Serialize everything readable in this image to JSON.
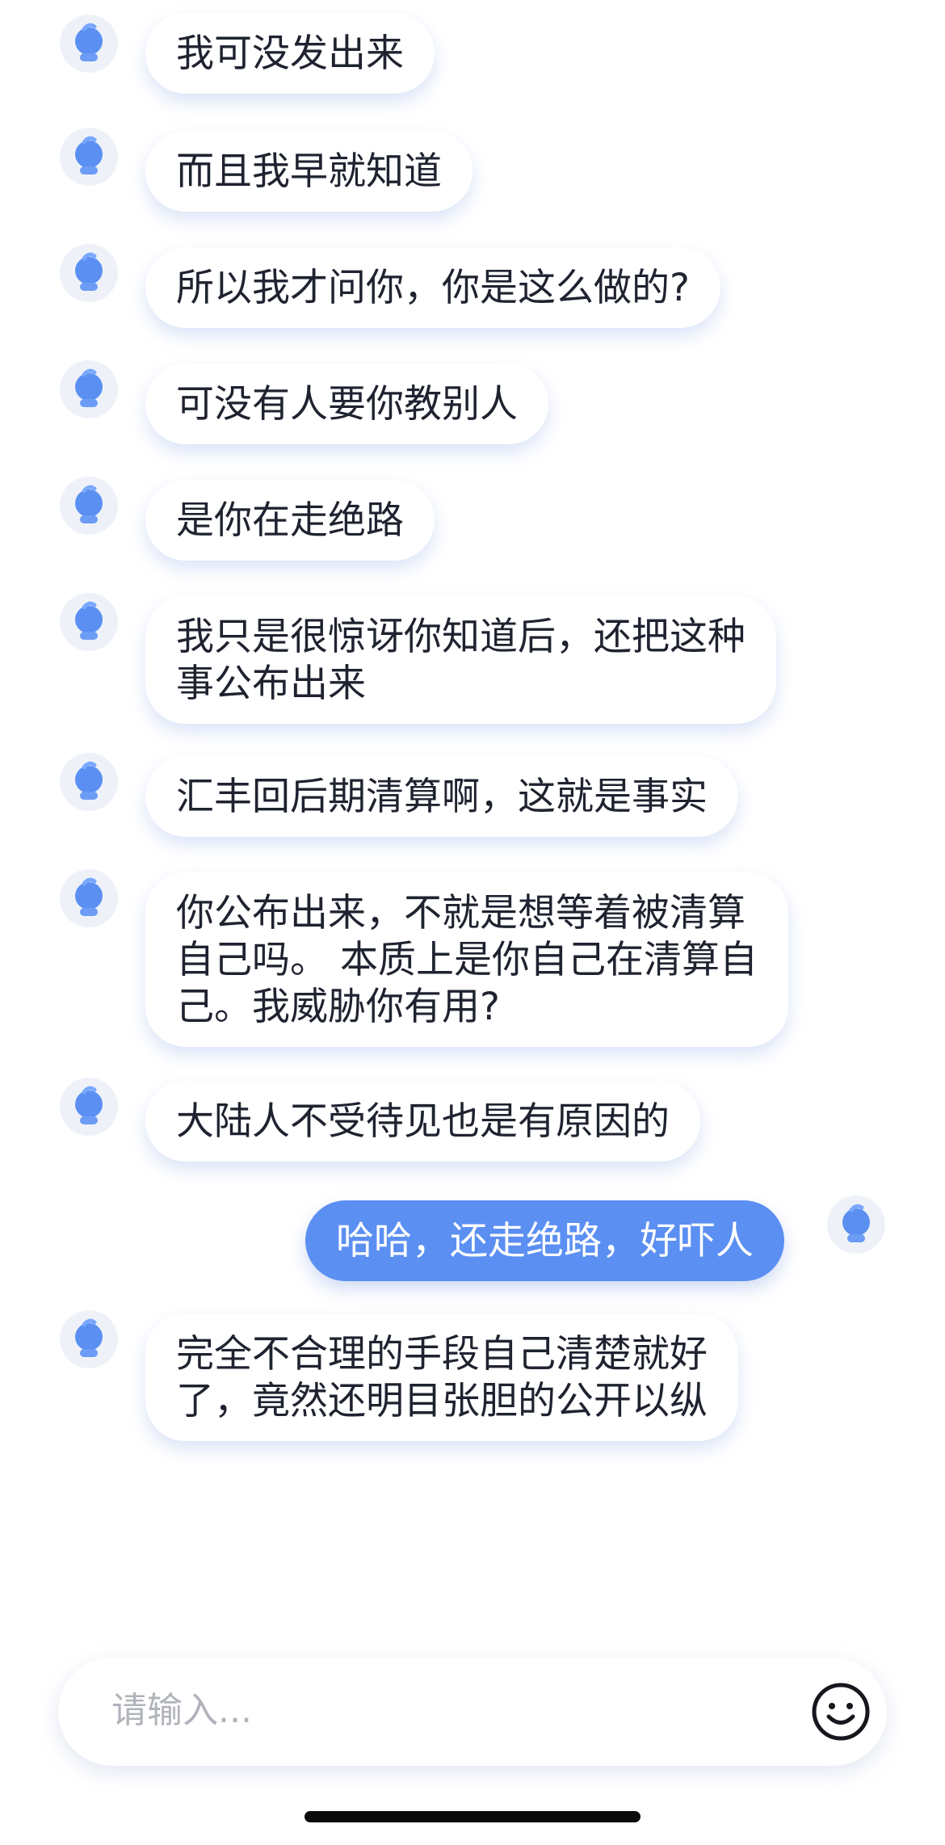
{
  "messages": [
    {
      "side": "received",
      "text": "我可没发出来"
    },
    {
      "side": "received",
      "text": "而且我早就知道"
    },
    {
      "side": "received",
      "text": "所以我才问你，你是这么做的?"
    },
    {
      "side": "received",
      "text": "可没有人要你教别人"
    },
    {
      "side": "received",
      "text": "是你在走绝路"
    },
    {
      "side": "received",
      "lines": [
        "我只是很惊讶你知道后，还把这种",
        "事公布出来"
      ]
    },
    {
      "side": "received",
      "text": "汇丰回后期清算啊，这就是事实"
    },
    {
      "side": "received",
      "lines": [
        "你公布出来，不就是想等着被清算",
        "自己吗。 本质上是你自己在清算自",
        "己。我威胁你有用?"
      ]
    },
    {
      "side": "received",
      "text": "大陆人不受待见也是有原因的"
    },
    {
      "side": "sent",
      "text": "哈哈，还走绝路，好吓人"
    },
    {
      "side": "received",
      "lines": [
        "完全不合理的手段自己清楚就好",
        "了，竟然还明目张胆的公开以纵"
      ]
    }
  ],
  "input": {
    "placeholder": "请输入..."
  },
  "icons": {
    "avatar": "bot-avatar-icon",
    "emoji": "smiley-face-icon"
  },
  "colors": {
    "sent_bubble": "#5b8ff2",
    "avatar_blue": "#5b8ff2"
  }
}
